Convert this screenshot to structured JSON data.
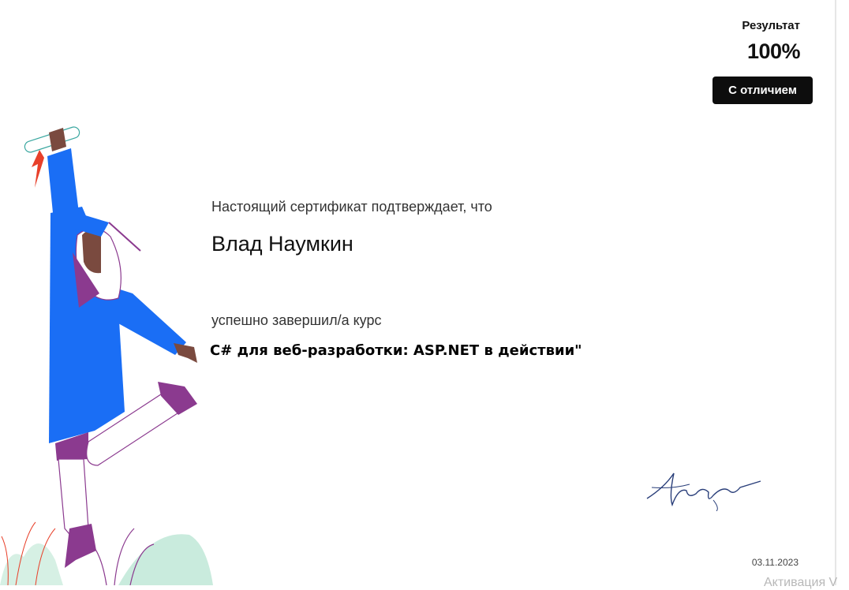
{
  "certificate": {
    "result_label": "Результат",
    "result_value": "100%",
    "honors_label": "С отличием",
    "intro": "Настоящий сертификат подтверждает, что",
    "recipient_name": "Влад Наумкин",
    "completed": "успешно завершил/а  курс",
    "course_title": "C# для веб-разработки: ASP.NET в действии\"",
    "date": "03.11.2023"
  },
  "overlay": {
    "watermark": "Активация V"
  },
  "colors": {
    "gown_blue": "#1a6ef5",
    "accent_purple": "#8b3a8f",
    "skin_brown": "#7a4a3f",
    "ribbon_red": "#e8402a",
    "grass_mint": "#c9ebdd",
    "signature_navy": "#2a3f7a",
    "badge_black": "#0d0d0d"
  }
}
